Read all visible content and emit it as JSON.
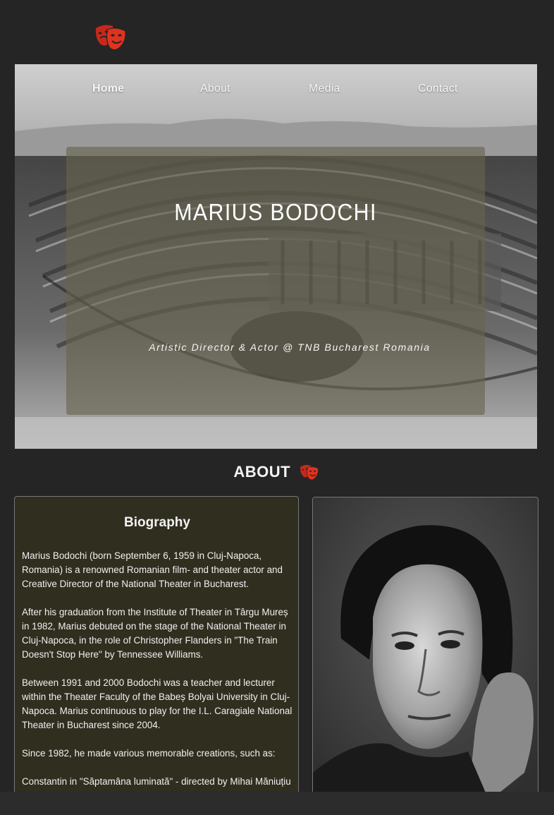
{
  "nav": {
    "items": [
      {
        "label": "Home",
        "active": true
      },
      {
        "label": "About",
        "active": false
      },
      {
        "label": "Media",
        "active": false
      },
      {
        "label": "Contact",
        "active": false
      }
    ]
  },
  "hero": {
    "title": "MARIUS BODOCHI",
    "subtitle": "Artistic Director & Actor @ TNB Bucharest Romania"
  },
  "about": {
    "heading": "ABOUT",
    "bio_title": "Biography",
    "paragraphs": [
      "Marius Bodochi (born September 6, 1959 in Cluj-Napoca, Romania) is a renowned Romanian film- and theater actor and Creative Director of the National Theater in Bucharest.",
      "After his graduation from the Institute of Theater in Târgu Mureș in 1982, Marius debuted on the stage of the National Theater in Cluj-Napoca, in the role of Christopher Flanders in \"The Train Doesn't Stop Here\" by Tennessee Williams.",
      "Between 1991 and 2000 Bodochi was a teacher and lecturer within the Theater Faculty of the Babeș Bolyai University in Cluj-Napoca. Marius continuous to play for the I.L. Caragiale National Theater in Bucharest since 2004.",
      "Since 1982, he made various memorable creations, such as:",
      "Constantin in \"Săptamâna luminată\" - directed by Mihai Măniuțiu"
    ]
  },
  "icons": {
    "logo": "theater-masks-icon",
    "about": "theater-masks-icon"
  },
  "colors": {
    "background": "#252525",
    "mask_red": "#d42a1c",
    "bio_panel": "#302e1f"
  }
}
